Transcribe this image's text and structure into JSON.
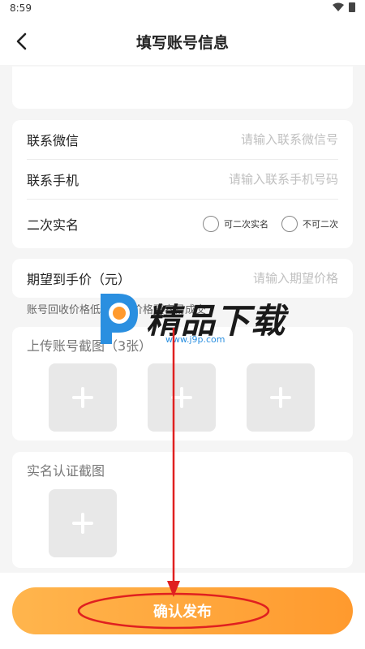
{
  "status_bar": {
    "time": "8:59"
  },
  "header": {
    "title": "填写账号信息"
  },
  "contact": {
    "wechat_label": "联系微信",
    "wechat_placeholder": "请输入联系微信号",
    "phone_label": "联系手机",
    "phone_placeholder": "请输入联系手机号码",
    "realname_label": "二次实名",
    "option_yes": "可二次实名",
    "option_no": "不可二次"
  },
  "price": {
    "label": "期望到手价（元）",
    "placeholder": "请输入期望价格"
  },
  "hint": "账号回收价格低，合理价格更容易成交",
  "upload": {
    "title": "上传账号截图（3张）"
  },
  "realname_upload": {
    "title": "实名认证截图"
  },
  "confirm": {
    "label": "确认发布"
  },
  "watermark": {
    "text": "精品下载",
    "url": "www.j9p.com"
  },
  "colors": {
    "accent": "#ff9a2e",
    "annotation": "#e02020",
    "placeholder": "#c0c0c0"
  },
  "icons": [
    "back-arrow-icon",
    "wifi-icon",
    "battery-icon",
    "plus-icon"
  ]
}
